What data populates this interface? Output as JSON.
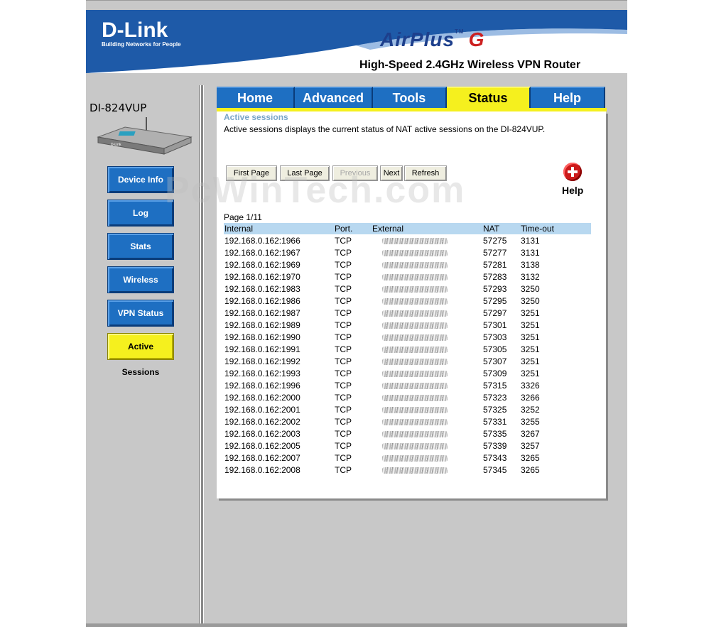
{
  "brand": {
    "logo": "D-Link",
    "tagline": "Building Networks for People",
    "product": "AirPlus",
    "product_g": "G",
    "tm": "TM",
    "subtitle": "High-Speed 2.4GHz Wireless VPN Router"
  },
  "device": {
    "model": "DI-824VUP"
  },
  "sidebar": {
    "items": [
      {
        "label": "Device Info"
      },
      {
        "label": "Log"
      },
      {
        "label": "Stats"
      },
      {
        "label": "Wireless"
      },
      {
        "label": "VPN Status"
      },
      {
        "label": "Active Sessions",
        "active": true
      }
    ]
  },
  "tabs": [
    {
      "label": "Home"
    },
    {
      "label": "Advanced"
    },
    {
      "label": "Tools"
    },
    {
      "label": "Status",
      "active": true
    },
    {
      "label": "Help"
    }
  ],
  "section": {
    "title": "Active sessions",
    "description": "Active sessions displays the current status of NAT active sessions on the DI-824VUP."
  },
  "paging": {
    "first": "First Page",
    "last": "Last Page",
    "previous": "Previous",
    "next": "Next",
    "refresh": "Refresh",
    "indicator": "Page 1/11"
  },
  "help": {
    "label": "Help"
  },
  "watermark": "PcWinTech.com",
  "table": {
    "headers": [
      "Internal",
      "Port.",
      "External",
      "NAT",
      "Time-out"
    ],
    "rows": [
      {
        "internal": "192.168.0.162:1966",
        "port": "TCP",
        "nat": "57275",
        "timeout": "3131"
      },
      {
        "internal": "192.168.0.162:1967",
        "port": "TCP",
        "nat": "57277",
        "timeout": "3131"
      },
      {
        "internal": "192.168.0.162:1969",
        "port": "TCP",
        "nat": "57281",
        "timeout": "3138"
      },
      {
        "internal": "192.168.0.162:1970",
        "port": "TCP",
        "nat": "57283",
        "timeout": "3132"
      },
      {
        "internal": "192.168.0.162:1983",
        "port": "TCP",
        "nat": "57293",
        "timeout": "3250"
      },
      {
        "internal": "192.168.0.162:1986",
        "port": "TCP",
        "nat": "57295",
        "timeout": "3250"
      },
      {
        "internal": "192.168.0.162:1987",
        "port": "TCP",
        "nat": "57297",
        "timeout": "3251"
      },
      {
        "internal": "192.168.0.162:1989",
        "port": "TCP",
        "nat": "57301",
        "timeout": "3251"
      },
      {
        "internal": "192.168.0.162:1990",
        "port": "TCP",
        "nat": "57303",
        "timeout": "3251"
      },
      {
        "internal": "192.168.0.162:1991",
        "port": "TCP",
        "nat": "57305",
        "timeout": "3251"
      },
      {
        "internal": "192.168.0.162:1992",
        "port": "TCP",
        "nat": "57307",
        "timeout": "3251"
      },
      {
        "internal": "192.168.0.162:1993",
        "port": "TCP",
        "nat": "57309",
        "timeout": "3251"
      },
      {
        "internal": "192.168.0.162:1996",
        "port": "TCP",
        "nat": "57315",
        "timeout": "3326"
      },
      {
        "internal": "192.168.0.162:2000",
        "port": "TCP",
        "nat": "57323",
        "timeout": "3266"
      },
      {
        "internal": "192.168.0.162:2001",
        "port": "TCP",
        "nat": "57325",
        "timeout": "3252"
      },
      {
        "internal": "192.168.0.162:2002",
        "port": "TCP",
        "nat": "57331",
        "timeout": "3255"
      },
      {
        "internal": "192.168.0.162:2003",
        "port": "TCP",
        "nat": "57335",
        "timeout": "3267"
      },
      {
        "internal": "192.168.0.162:2005",
        "port": "TCP",
        "nat": "57339",
        "timeout": "3257"
      },
      {
        "internal": "192.168.0.162:2007",
        "port": "TCP",
        "nat": "57343",
        "timeout": "3265"
      },
      {
        "internal": "192.168.0.162:2008",
        "port": "TCP",
        "nat": "57345",
        "timeout": "3265"
      }
    ]
  },
  "colors": {
    "brand_blue": "#1e6fc2",
    "active_yellow": "#f5f01e",
    "header_row": "#b8d8f0",
    "section_title": "#7aa6c8"
  }
}
